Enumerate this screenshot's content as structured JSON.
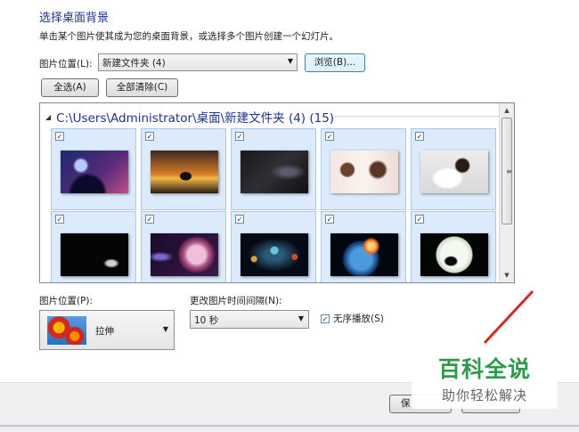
{
  "header": {
    "title": "选择桌面背景",
    "subtitle": "单击某个图片使其成为您的桌面背景，或选择多个图片创建一个幻灯片。"
  },
  "location": {
    "label": "图片位置(L):",
    "value": "新建文件夹 (4)",
    "browse_label": "浏览(B)..."
  },
  "select_all_label": "全选(A)",
  "clear_all_label": "全部清除(C)",
  "gallery": {
    "header": "C:\\Users\\Administrator\\桌面\\新建文件夹 (4) (15)",
    "images": [
      {
        "name": "silhouette-moon-wallpaper",
        "checked": true
      },
      {
        "name": "sunset-silhouette-wallpaper",
        "checked": true
      },
      {
        "name": "dark-abstract-wallpaper",
        "checked": true
      },
      {
        "name": "woman-portrait-wallpaper",
        "checked": true
      },
      {
        "name": "woman-reclining-wallpaper",
        "checked": true
      },
      {
        "name": "astronaut-space-wallpaper",
        "checked": true
      },
      {
        "name": "pink-planet-wallpaper",
        "checked": true
      },
      {
        "name": "planets-orbit-wallpaper",
        "checked": true
      },
      {
        "name": "planet-explosion-wallpaper",
        "checked": true
      },
      {
        "name": "wolf-moon-wallpaper",
        "checked": true
      }
    ]
  },
  "picture_position": {
    "label": "图片位置(P):",
    "value": "拉伸"
  },
  "interval": {
    "label": "更改图片时间间隔(N):",
    "value": "10 秒"
  },
  "shuffle": {
    "label": "无序播放(S)",
    "checked": true
  },
  "footer": {
    "save_label": "保"
  },
  "watermark": {
    "main": "百科全说",
    "sub": "助你轻松解决"
  }
}
